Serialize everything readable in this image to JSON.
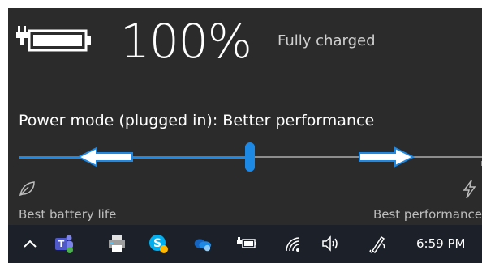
{
  "battery": {
    "percent": "100%",
    "status": "Fully charged",
    "icon": "plugged-in-battery-icon"
  },
  "power_mode": {
    "label": "Power mode (plugged in): Better performance",
    "slider_level": 0.5,
    "left_label": "Best battery life",
    "right_label": "Best performance",
    "left_icon": "leaf-icon",
    "right_icon": "lightning-bolt-icon"
  },
  "taskbar": {
    "icons": [
      "chevron-up-icon",
      "teams-icon",
      "printer-icon",
      "skype-icon",
      "onedrive-icon",
      "battery-icon",
      "wifi-icon",
      "volume-icon",
      "pen-icon"
    ],
    "time": "6:59 PM"
  },
  "colors": {
    "flyout_bg": "#2b2b2b",
    "taskbar_bg": "#1c2129",
    "accent": "#1e88e5",
    "track_inactive": "#8d8d8d"
  }
}
